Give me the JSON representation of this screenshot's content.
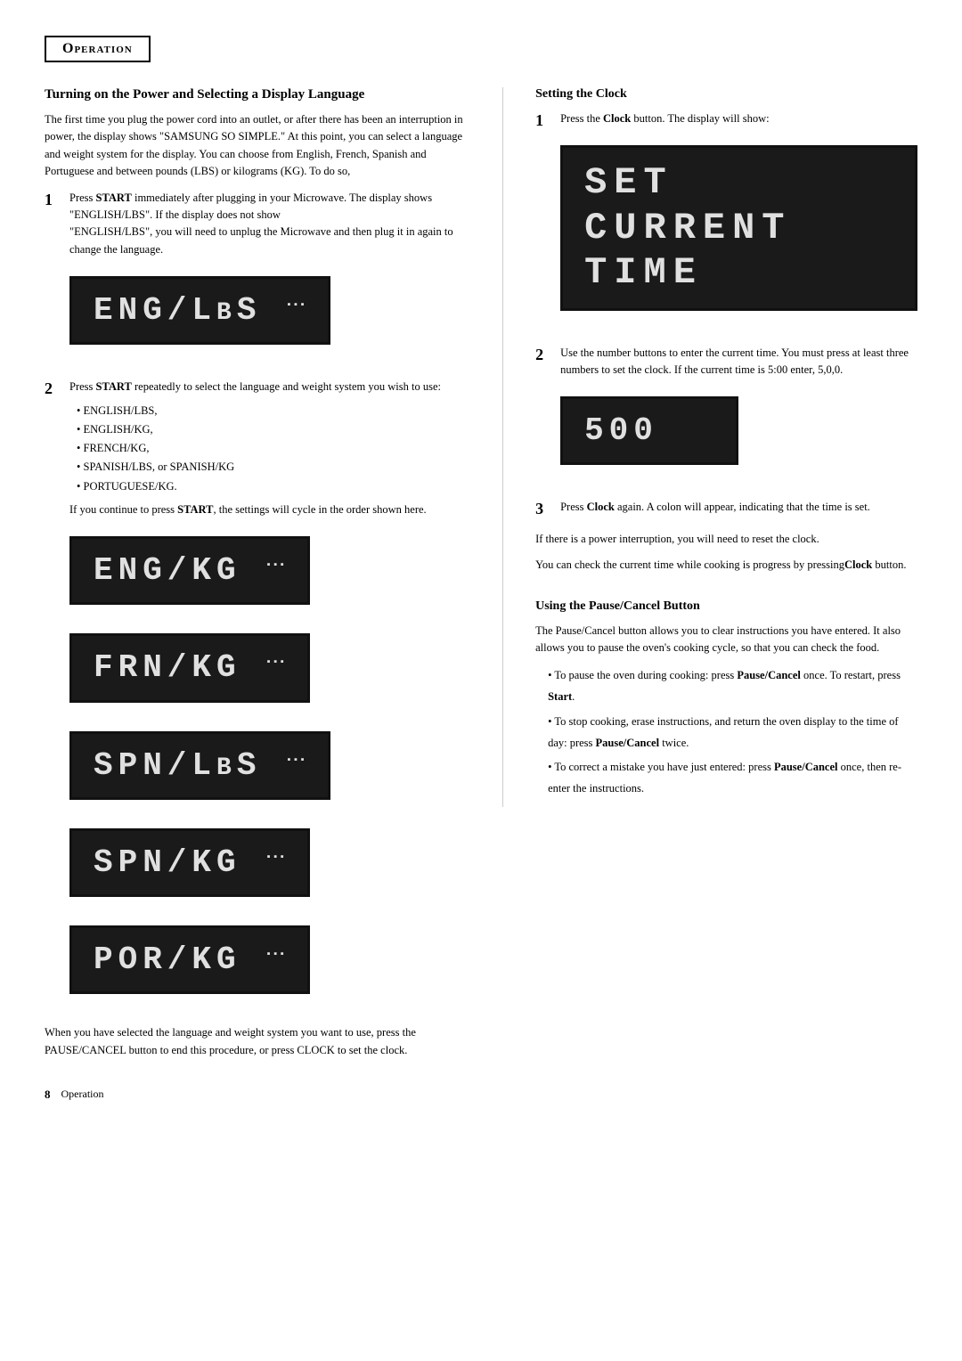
{
  "header": {
    "title": "Operation"
  },
  "left_col": {
    "section_title": "Turning on the Power and Selecting a Display Language",
    "intro_text": "The first time you plug the power cord into an outlet, or after there has been an interruption in power, the display shows \"SAMSUNG SO SIMPLE.\" At this point, you can select a language and weight system for the display. You can choose from English, French, Spanish and Portuguese and between pounds (LBS) or kilograms (KG). To do so,",
    "step1": {
      "num": "1",
      "text": "Press START immediately after plugging in your Microwave. The display shows \"ENGLISH/LBS\". If the display does not show \"ENGLISH/LBS\", you will need to unplug the Microwave and then plug it in again to change the language.",
      "display": "ENG/LBS"
    },
    "step2": {
      "num": "2",
      "text": "Press START repeatedly to select the language and weight system you wish to use:",
      "options": [
        "ENGLISH/LBS,",
        "ENGLISH/KG,",
        "FRENCH/KG,",
        "SPANISH/LBS, or  SPANISH/KG",
        "PORTUGUESE/KG."
      ],
      "continue_text": "If you continue to press START, the settings will cycle in the order shown here.",
      "displays": [
        "ENG/KG",
        "FRN/KG",
        "SPN/LBS",
        "SPN/KG",
        "POR/KG"
      ]
    },
    "footer_text": "When you have selected the language and weight system you want to use, press the PAUSE/CANCEL button to end this procedure, or press CLOCK to set the clock."
  },
  "right_col": {
    "clock_section": {
      "title": "Setting the Clock",
      "step1": {
        "num": "1",
        "text": "Press the Clock button.  The display will show:",
        "display": "SET CURRENT TIME"
      },
      "step2": {
        "num": "2",
        "text": "Use the number buttons to enter the current time. You must press at least three numbers to set the clock. If the current time is 5:00 enter, 5,0,0.",
        "display": "500"
      },
      "step3": {
        "num": "3",
        "text": "Press Clock again. A colon will appear, indicating that the time is set."
      },
      "interruption_text": "If there is a power interruption, you will need to reset the clock.",
      "check_text": "You can check the current time while cooking is progress by pressing",
      "check_bold": "Clock",
      "check_end": " button."
    },
    "pause_section": {
      "title": "Using the Pause/Cancel Button",
      "intro": "The Pause/Cancel button allows you to clear instructions you have entered.  It also allows you to pause the oven's cooking cycle, so that you can check the food.",
      "bullets": [
        {
          "text": "To pause the oven during cooking: press Pause/Cancel once. To restart, press Start."
        },
        {
          "text": "To stop cooking, erase instructions, and return the oven display to the time of day: press Pause/Cancel twice."
        },
        {
          "text": "To correct a mistake you have just entered: press Pause/Cancel once, then re-enter the instructions."
        }
      ]
    }
  },
  "page_footer": {
    "page_num": "8",
    "section_label": "Operation"
  }
}
